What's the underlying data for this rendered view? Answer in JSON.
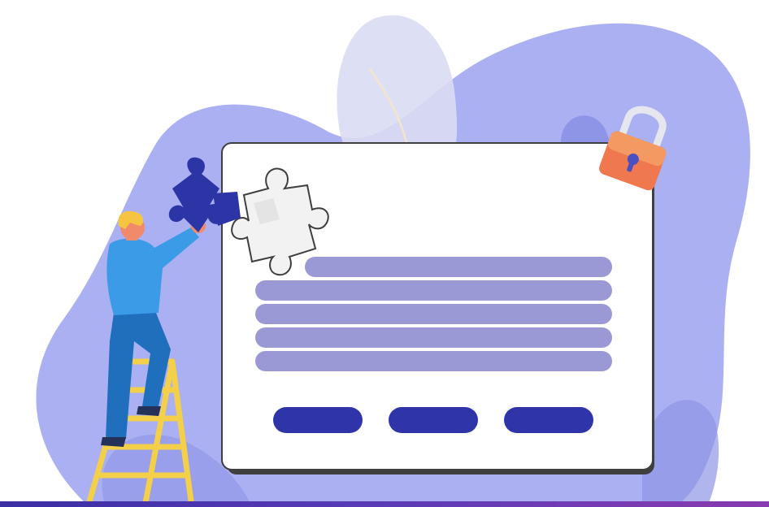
{
  "scene": {
    "description_free": true,
    "palette": {
      "blob_main": "#aab0f2",
      "blob_dark": "#8f95e6",
      "blob_light": "#d9dbf3",
      "panel": "#ffffff",
      "panel_border": "#3f3f3f",
      "text_line": "#9b98d6",
      "button": "#2f34a8",
      "puzzle_piece": "#2c35a5",
      "padlock_body_top": "#f39a62",
      "padlock_body_bottom": "#f0784e",
      "padlock_shackle": "#e6e6ee",
      "keyhole": "#4a4fc2",
      "shirt": "#3b9be6",
      "pants": "#1f6fbd",
      "hair": "#f5c542",
      "skin": "#f08a6a",
      "ladder": "#f3cf4a",
      "bottom_bar_start": "#3b2fa6",
      "bottom_bar_end": "#8a3bb0"
    },
    "icons": [
      "puzzle-piece-icon",
      "puzzle-hole-icon",
      "padlock-icon"
    ]
  }
}
